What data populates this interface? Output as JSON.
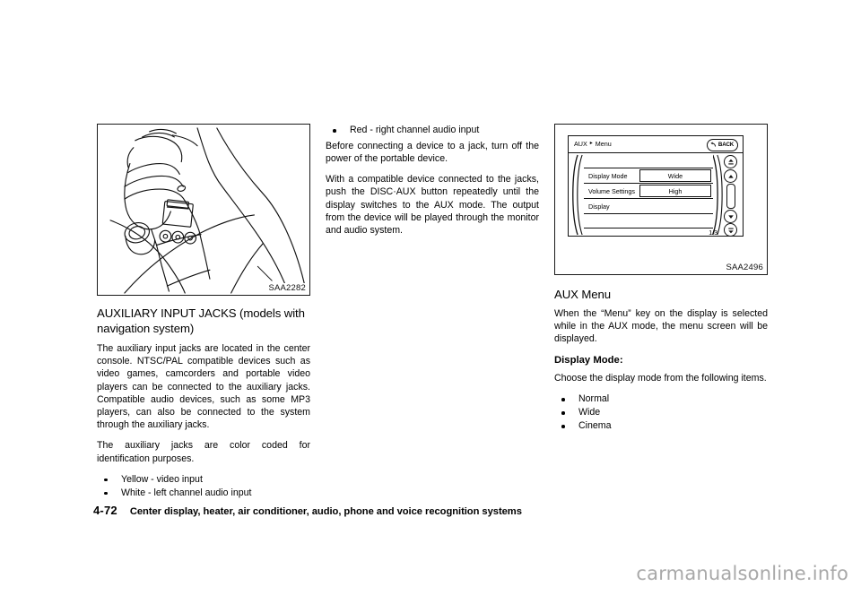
{
  "document": {
    "page_number": "4-72",
    "footer_title": "Center display, heater, air conditioner, audio, phone and voice recognition systems",
    "watermark": "carmanualsonline.info"
  },
  "figures": {
    "left": {
      "caption": "SAA2282",
      "alt": "Center console auxiliary input jacks illustration"
    },
    "right": {
      "caption": "SAA2496",
      "alt": "AUX Menu screen illustration",
      "screen": {
        "breadcrumb_root": "AUX",
        "breadcrumb_sep": "▸",
        "breadcrumb_leaf": "Menu",
        "back_label": "BACK",
        "back_icon": "back-arrow-icon",
        "rows": [
          {
            "label": "Display Mode",
            "value": "Wide"
          },
          {
            "label": "Volume Settings",
            "value": "High"
          },
          {
            "label": "Display",
            "value": ""
          },
          {
            "label": "",
            "value": ""
          },
          {
            "label": "",
            "value": ""
          }
        ],
        "page_indicator": "1/3",
        "scroll_buttons": [
          "double-up-arrow-icon",
          "up-arrow-icon",
          "scrollbar-thumb",
          "down-arrow-icon",
          "double-down-arrow-icon"
        ]
      }
    }
  },
  "column1": {
    "heading": "AUXILIARY INPUT JACKS (models with navigation system)",
    "paragraph1": "The auxiliary input jacks are located in the center console. NTSC/PAL compatible devices such as video games, camcorders and portable video players can be connected to the auxiliary jacks. Compatible audio devices, such as some MP3 players, can also be connected to the system through the auxiliary jacks.",
    "paragraph2": "The auxiliary jacks are color coded for identification purposes.",
    "bullets": [
      "Yellow - video input",
      "White - left channel audio input"
    ]
  },
  "column2": {
    "bullets": [
      "Red - right channel audio input"
    ],
    "paragraph1": "Before connecting a device to a jack, turn off the power of the portable device.",
    "paragraph2": "With a compatible device connected to the jacks, push the DISC·AUX button repeatedly until the display switches to the AUX mode. The output from the device will be played through the monitor and audio system."
  },
  "column3": {
    "heading": "AUX Menu",
    "paragraph1": "When the “Menu” key on the display is selected while in the AUX mode, the menu screen will be displayed.",
    "subheading": "Display Mode:",
    "paragraph2": "Choose the display mode from the following items.",
    "bullets": [
      "Normal",
      "Wide",
      "Cinema"
    ]
  }
}
